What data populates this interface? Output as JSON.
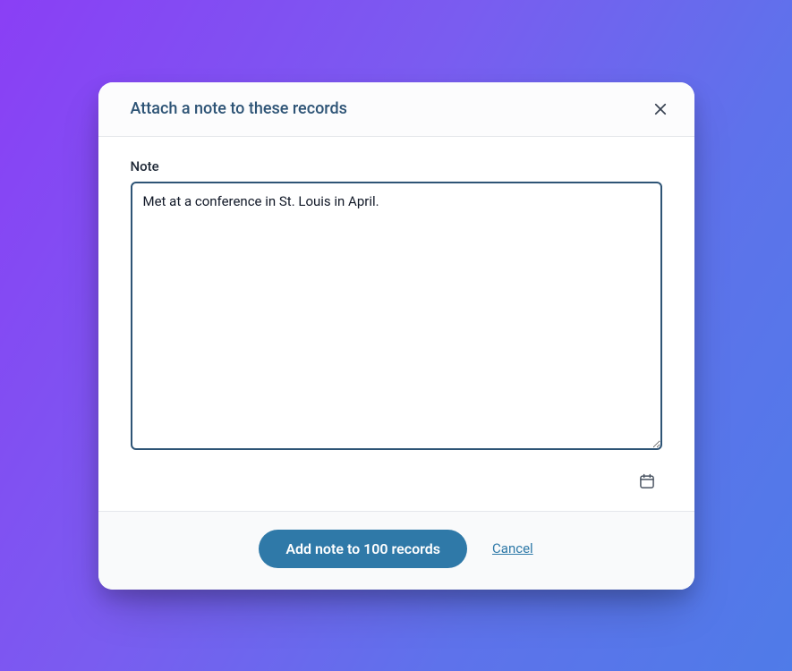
{
  "modal": {
    "title": "Attach a note to these records",
    "note_label": "Note",
    "note_value": "Met at a conference in St. Louis in April. ",
    "submit_label": "Add note to 100 records",
    "cancel_label": "Cancel"
  }
}
